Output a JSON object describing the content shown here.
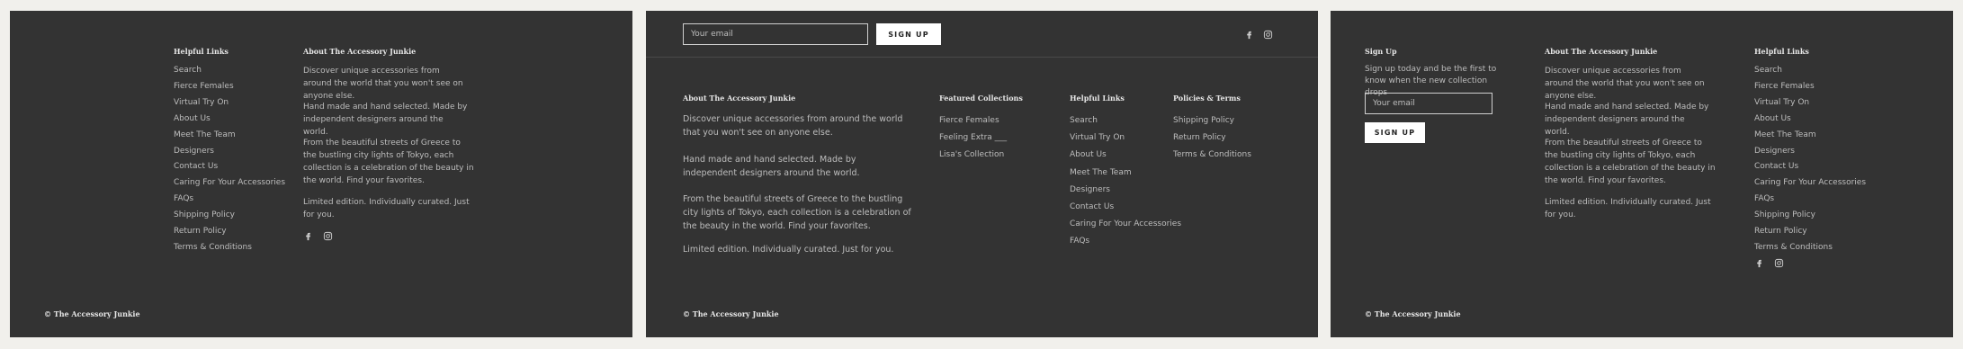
{
  "panel1": {
    "helpful_links": {
      "title": "Helpful Links",
      "items": [
        "Search",
        "Fierce Females",
        "Virtual Try On",
        "About Us",
        "Meet The Team",
        "Designers",
        "Contact Us",
        "Caring For Your Accessories",
        "FAQs",
        "Shipping Policy",
        "Return Policy",
        "Terms & Conditions"
      ]
    },
    "about": {
      "title": "About The Accessory Junkie",
      "p1": "Discover unique accessories from around the world that you won't see on anyone else.",
      "p2": "Hand made and hand selected.  Made by independent designers around the world.",
      "p3": "From the beautiful streets of Greece to the bustling city lights of Tokyo, each collection is a celebration of the beauty in the world. Find your favorites.",
      "p4": "Limited edition. Individually curated. Just for you."
    },
    "copyright": "© The Accessory Junkie"
  },
  "panel2": {
    "newsletter": {
      "email_placeholder": "Your email",
      "signup_label": "SIGN UP"
    },
    "about": {
      "title": "About The Accessory Junkie",
      "p1": "Discover unique accessories from around the world that you won't see on anyone else.",
      "p2": "Hand made and hand selected.  Made by independent designers around the world.",
      "p3": "From the beautiful streets of Greece to the bustling city lights of Tokyo, each collection is a celebration of the beauty in the world. Find your favorites.",
      "p4": "Limited edition. Individually curated. Just for you."
    },
    "featured": {
      "title": "Featured Collections",
      "items": [
        "Fierce Females",
        "Feeling Extra ___",
        "Lisa's Collection"
      ]
    },
    "helpful_links": {
      "title": "Helpful Links",
      "items": [
        "Search",
        "Virtual Try On",
        "About Us",
        "Meet The Team",
        "Designers",
        "Contact Us",
        "Caring For Your Accessories",
        "FAQs"
      ]
    },
    "policies": {
      "title": "Policies & Terms",
      "items": [
        "Shipping Policy",
        "Return Policy",
        "Terms & Conditions"
      ]
    },
    "copyright": "© The Accessory Junkie"
  },
  "panel3": {
    "signup": {
      "title": "Sign Up",
      "text": "Sign up today and be the first to know when the new collection drops",
      "email_placeholder": "Your email",
      "signup_label": "SIGN UP"
    },
    "about": {
      "title": "About The Accessory Junkie",
      "p1": "Discover unique accessories from around the world that you won't see on anyone else.",
      "p2": "Hand made and hand selected.  Made by independent designers around the world.",
      "p3": "From the beautiful streets of Greece to the bustling city lights of Tokyo, each collection is a celebration of the beauty in the world. Find your favorites.",
      "p4": "Limited edition. Individually curated. Just for you."
    },
    "helpful_links": {
      "title": "Helpful Links",
      "items": [
        "Search",
        "Fierce Females",
        "Virtual Try On",
        "About Us",
        "Meet The Team",
        "Designers",
        "Contact Us",
        "Caring For Your Accessories",
        "FAQs",
        "Shipping Policy",
        "Return Policy",
        "Terms & Conditions"
      ]
    },
    "copyright": "© The Accessory Junkie"
  },
  "icons": [
    "facebook-icon",
    "instagram-icon"
  ],
  "colors": {
    "panel_bg": "#333333",
    "page_bg": "#f1f0ec",
    "text": "#bdbdbd",
    "heading": "#e6e6e6",
    "button_bg": "#ffffff"
  }
}
